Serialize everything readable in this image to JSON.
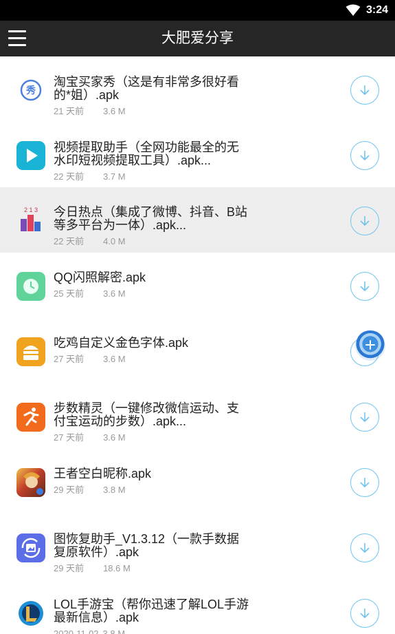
{
  "status_bar": {
    "time": "3:24"
  },
  "app_bar": {
    "title": "大肥爱分享"
  },
  "items": [
    {
      "name": "淘宝买家秀（这是有非常多很好看\n的*姐）.apk",
      "age": "21 天前",
      "size": "3.6 M",
      "icon": "taobao-xiu-icon",
      "icon_text": "秀"
    },
    {
      "name": "视频提取助手（全网功能最全的无\n水印短视频提取工具）.apk...",
      "age": "22 天前",
      "size": "3.7 M",
      "icon": "video-extract-play-icon"
    },
    {
      "name": "今日热点（集成了微博、抖音、B站\n等多平台为一体）.apk...",
      "age": "22 天前",
      "size": "4.0 M",
      "icon": "hot-ranking-podium-icon",
      "icon_text": "2 1 3"
    },
    {
      "name": "QQ闪照解密.apk",
      "age": "25 天前",
      "size": "3.6 M",
      "icon": "clock-icon"
    },
    {
      "name": "吃鸡自定义金色字体.apk",
      "age": "27 天前",
      "size": "3.6 M",
      "icon": "burger-stack-icon"
    },
    {
      "name": "步数精灵（一键修改微信运动、支\n付宝运动的步数）.apk...",
      "age": "27 天前",
      "size": "3.6 M",
      "icon": "running-man-icon"
    },
    {
      "name": "王者空白昵称.apk",
      "age": "29 天前",
      "size": "3.8 M",
      "icon": "game-hero-icon"
    },
    {
      "name": "图恢复助手_V1.3.12（一款手数据\n复原软件）.apk",
      "age": "29 天前",
      "size": "18.6 M",
      "icon": "photo-recovery-icon"
    },
    {
      "name": "LOL手游宝（帮你迅速了解LOL手游\n最新信息）.apk",
      "age": "2020-11-02",
      "size": "3.8 M",
      "icon": "lol-logo-icon"
    }
  ],
  "colors": {
    "accent": "#6fc4ef",
    "app_bar": "#262626",
    "highlight_row": "#eeeeee"
  }
}
